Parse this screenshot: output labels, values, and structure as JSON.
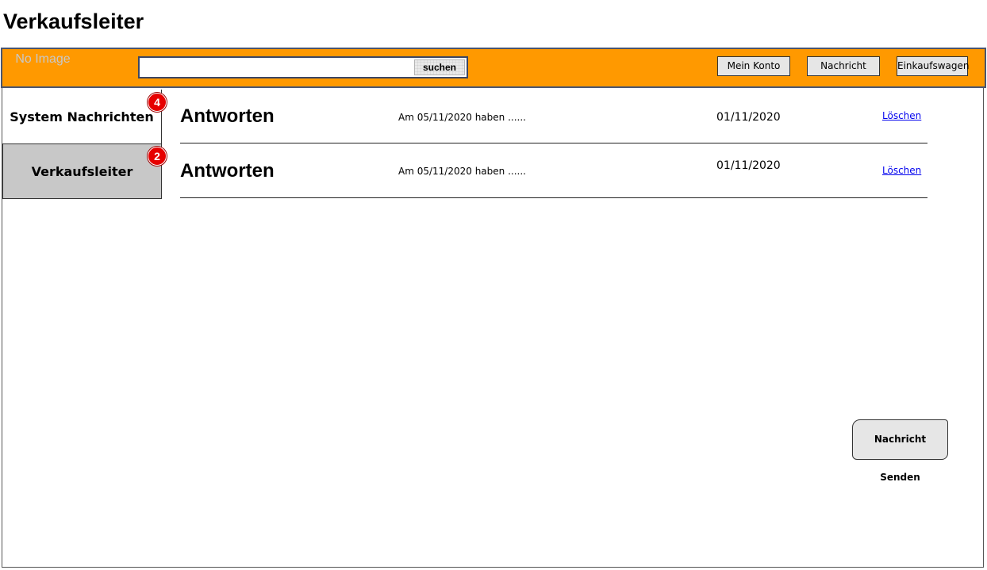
{
  "page": {
    "title": "Verkaufsleiter"
  },
  "topbar": {
    "logo_text": "No Image",
    "search": {
      "value": "",
      "button_label": "suchen"
    },
    "nav": {
      "account_label": "Mein Konto",
      "message_label": "Nachricht",
      "cart_label": "Einkaufswagen"
    }
  },
  "tabs": [
    {
      "label": "System Nachrichten",
      "badge": "4",
      "active": true
    },
    {
      "label": "Verkaufsleiter",
      "badge": "2",
      "active": false
    }
  ],
  "messages": [
    {
      "title": "Antworten",
      "preview": "Am 05/11/2020 haben ......",
      "date": "01/11/2020",
      "delete_label": "Löschen"
    },
    {
      "title": "Antworten",
      "preview": "Am 05/11/2020 haben ......",
      "date": "01/11/2020",
      "delete_label": "Löschen"
    }
  ],
  "actions": {
    "send_label": "Nachricht Senden"
  },
  "colors": {
    "topbar": "#ff9900",
    "badge": "#e60000",
    "link": "#0000ee",
    "tab_inactive": "#c8c8c8"
  }
}
